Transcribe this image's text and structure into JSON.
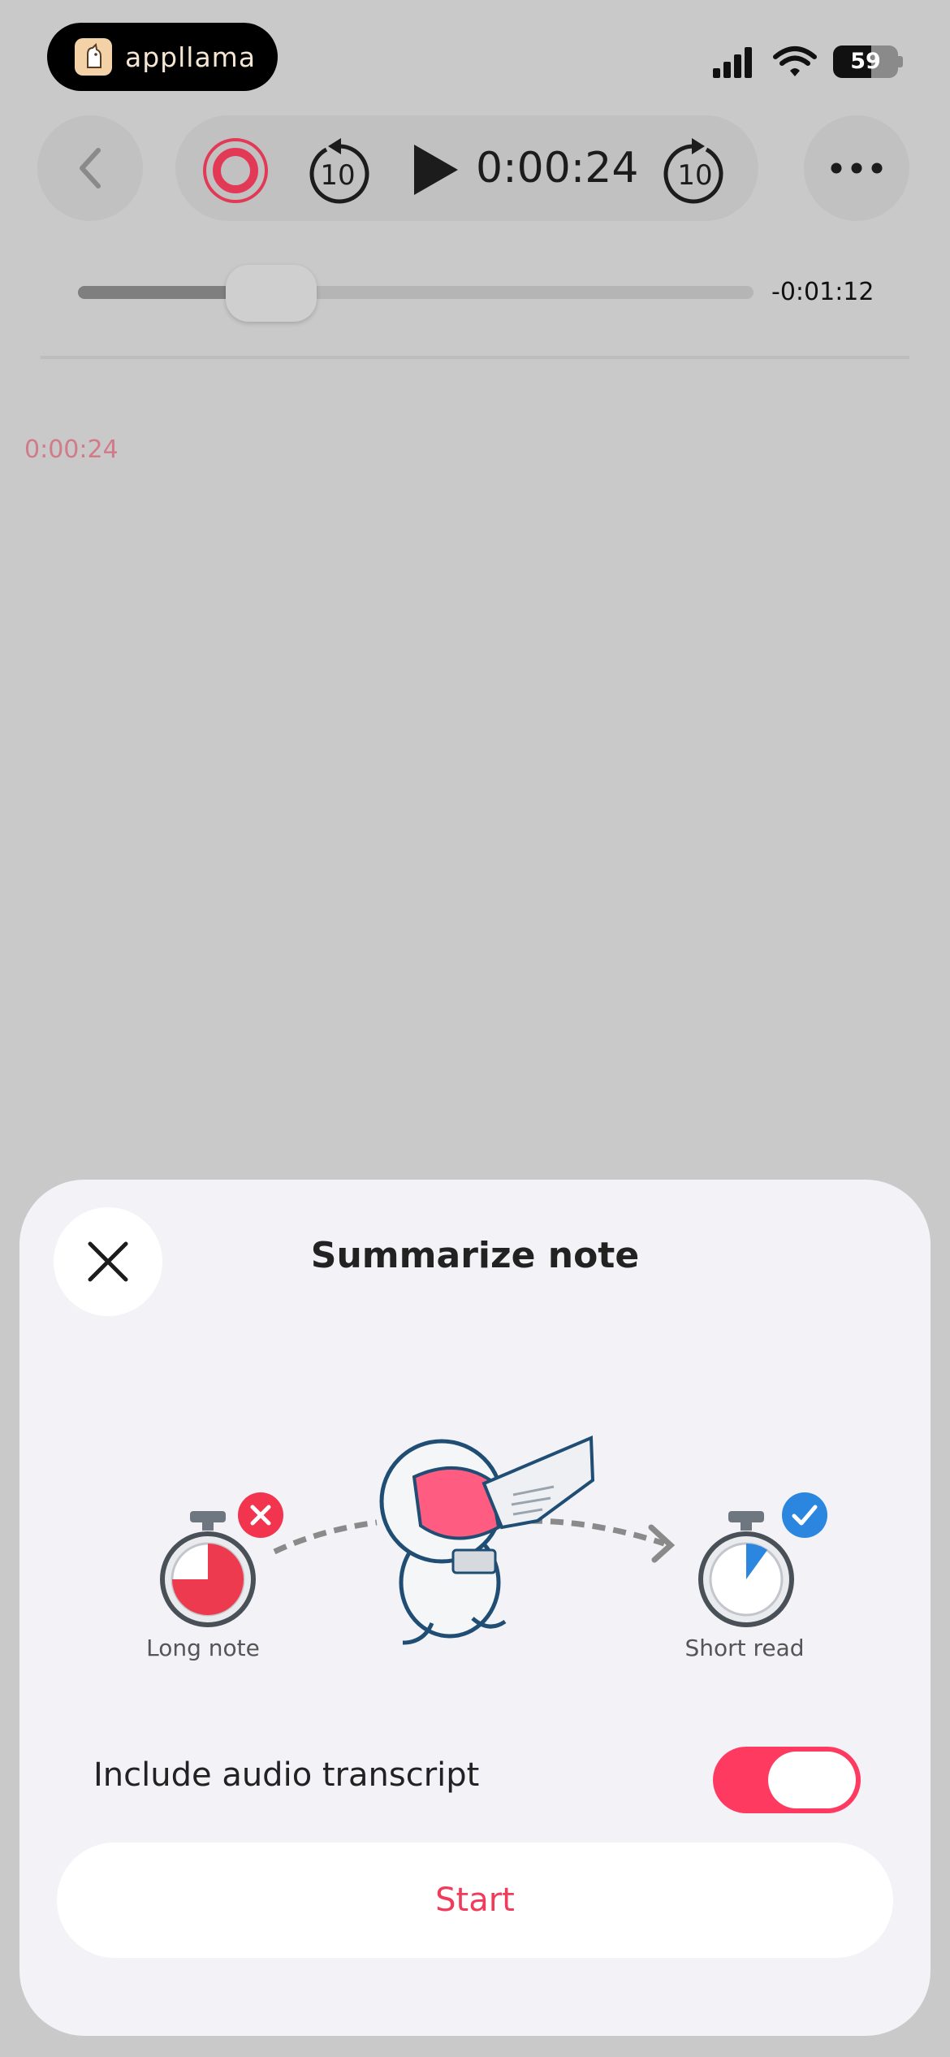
{
  "status_bar": {
    "app_name": "appllama",
    "battery_level": "59",
    "icons": [
      "app-logo-icon",
      "signal-icon",
      "wifi-icon",
      "battery-icon"
    ]
  },
  "player": {
    "elapsed": "0:00:24",
    "remaining": "-0:01:12",
    "progress_fraction": 0.25,
    "skip_back_seconds": "10",
    "skip_forward_seconds": "10",
    "icons": [
      "back-chevron-icon",
      "record-icon",
      "skip-back-icon",
      "play-icon",
      "skip-forward-icon",
      "more-icon"
    ],
    "record_color": "#e23a56"
  },
  "transcript": {
    "timestamp": "0:00:24"
  },
  "sheet": {
    "title": "Summarize note",
    "long_note_label": "Long note",
    "short_read_label": "Short read",
    "toggle_label": "Include audio transcript",
    "toggle_on": true,
    "start_label": "Start",
    "accent_color": "#fe3a60",
    "check_color": "#2b86e0",
    "icons": [
      "close-icon",
      "stopwatch-long-icon",
      "reject-badge-icon",
      "astronaut-illustration",
      "stopwatch-short-icon",
      "check-badge-icon"
    ]
  }
}
